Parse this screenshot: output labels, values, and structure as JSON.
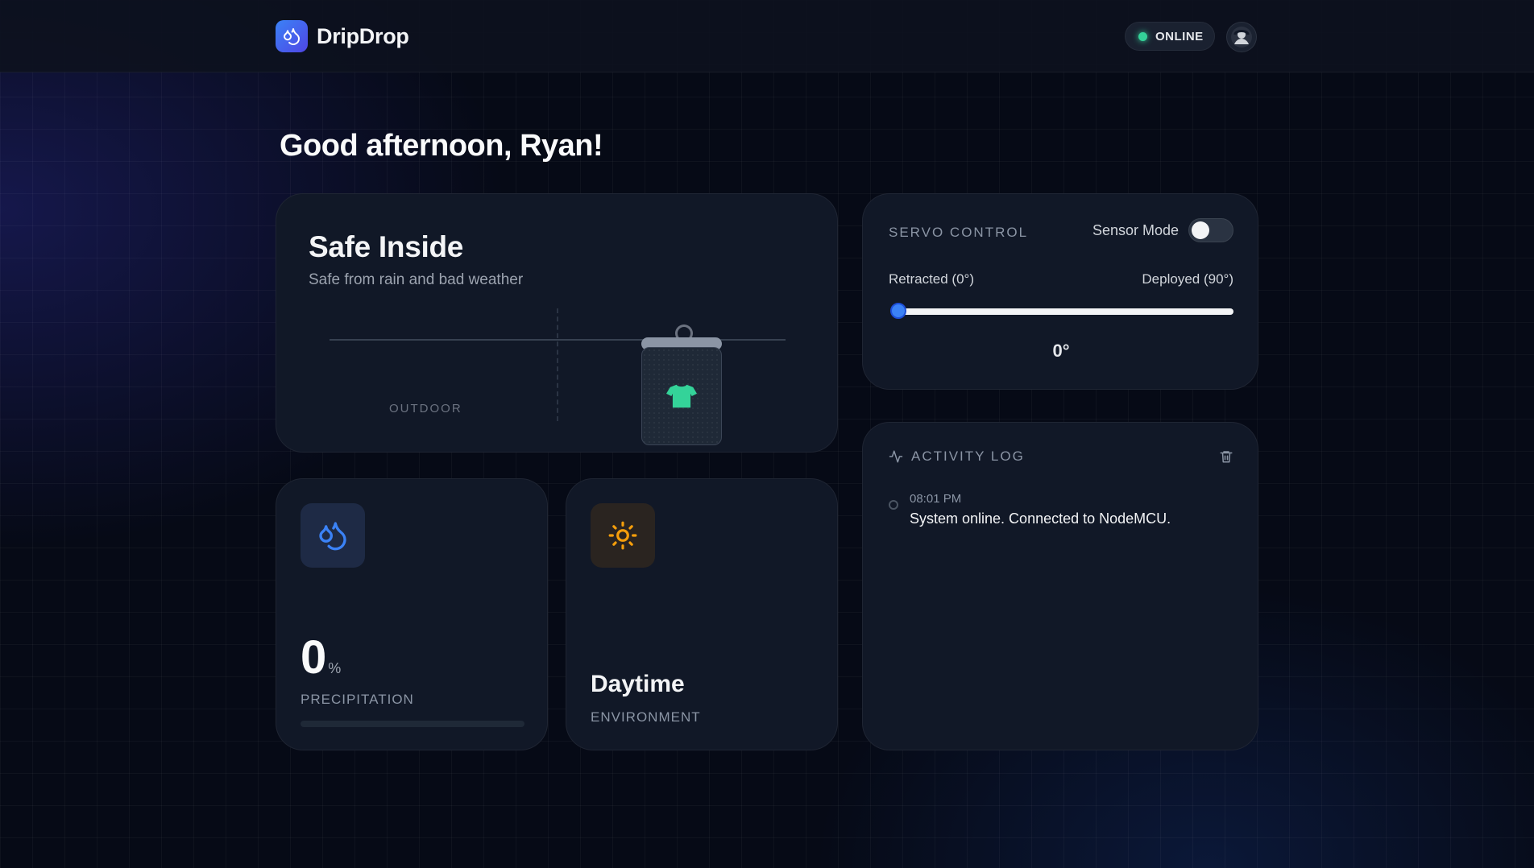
{
  "header": {
    "brand": "DripDrop",
    "status": "ONLINE"
  },
  "greeting": "Good afternoon, Ryan!",
  "hero": {
    "title": "Safe Inside",
    "subtitle": "Safe from rain and bad weather",
    "outdoor_label": "OUTDOOR"
  },
  "precipitation": {
    "value": "0",
    "unit": "%",
    "label": "PRECIPITATION",
    "level_percent": 0
  },
  "environment": {
    "value": "Daytime",
    "label": "ENVIRONMENT"
  },
  "servo": {
    "title": "SERVO CONTROL",
    "sensor_mode_label": "Sensor Mode",
    "sensor_mode_on": false,
    "min_label": "Retracted (0°)",
    "max_label": "Deployed (90°)",
    "angle": 0,
    "angle_max": 90,
    "angle_display": "0°"
  },
  "activity": {
    "title": "ACTIVITY LOG",
    "entries": [
      {
        "time": "08:01 PM",
        "message": "System online. Connected to NodeMCU."
      }
    ]
  },
  "colors": {
    "accent": "#3b82f6",
    "online": "#34d399",
    "sun": "#f59e0b",
    "shirt": "#34d399"
  },
  "icons": {
    "brand": "droplets-icon",
    "precipitation": "droplets-icon",
    "environment": "sun-icon",
    "activity": "activity-icon",
    "clear_log": "trash-icon",
    "garment": "shirt-icon"
  }
}
